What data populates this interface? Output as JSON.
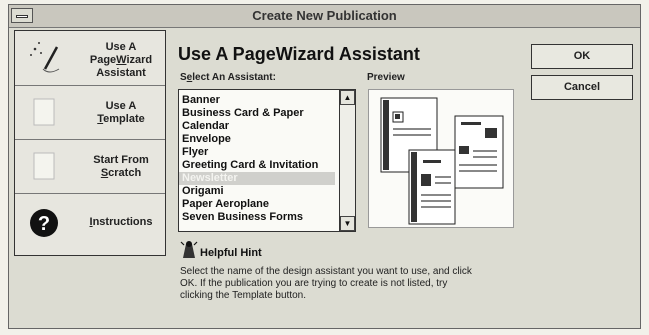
{
  "window": {
    "title": "Create New Publication"
  },
  "left_options": [
    {
      "line1": "Use A",
      "line2_pre": "Page",
      "line2_u": "W",
      "line2_post": "izard",
      "line3": "Assistant",
      "icon": "wand-icon"
    },
    {
      "line1": "Use A",
      "line2_pre": "",
      "line2_u": "T",
      "line2_post": "emplate",
      "icon": "template-icon"
    },
    {
      "line1": "Start From",
      "line2_pre": "",
      "line2_u": "S",
      "line2_post": "cratch",
      "icon": "blank-page-icon"
    },
    {
      "line1_pre": "",
      "line1_u": "I",
      "line1_post": "nstructions",
      "icon": "question-icon"
    }
  ],
  "main": {
    "heading": "Use A PageWizard Assistant",
    "select_label_pre": "S",
    "select_label_u": "e",
    "select_label_post": "lect An Assistant:",
    "preview_label": "Preview"
  },
  "assistant_list": {
    "items": [
      "Banner",
      "Business Card & Paper",
      "Calendar",
      "Envelope",
      "Flyer",
      "Greeting Card & Invitation",
      "Newsletter",
      "Origami",
      "Paper Aeroplane",
      "Seven Business Forms"
    ],
    "selected_index": 6,
    "scroll_up": "▲",
    "scroll_down": "▼"
  },
  "buttons": {
    "ok": "OK",
    "cancel": "Cancel"
  },
  "hint": {
    "title": "Helpful Hint",
    "lines": [
      "Select the name of the design assistant you want to use, and click",
      "OK.  If the publication you are trying to create is not listed, try",
      "clicking the Template button."
    ]
  }
}
